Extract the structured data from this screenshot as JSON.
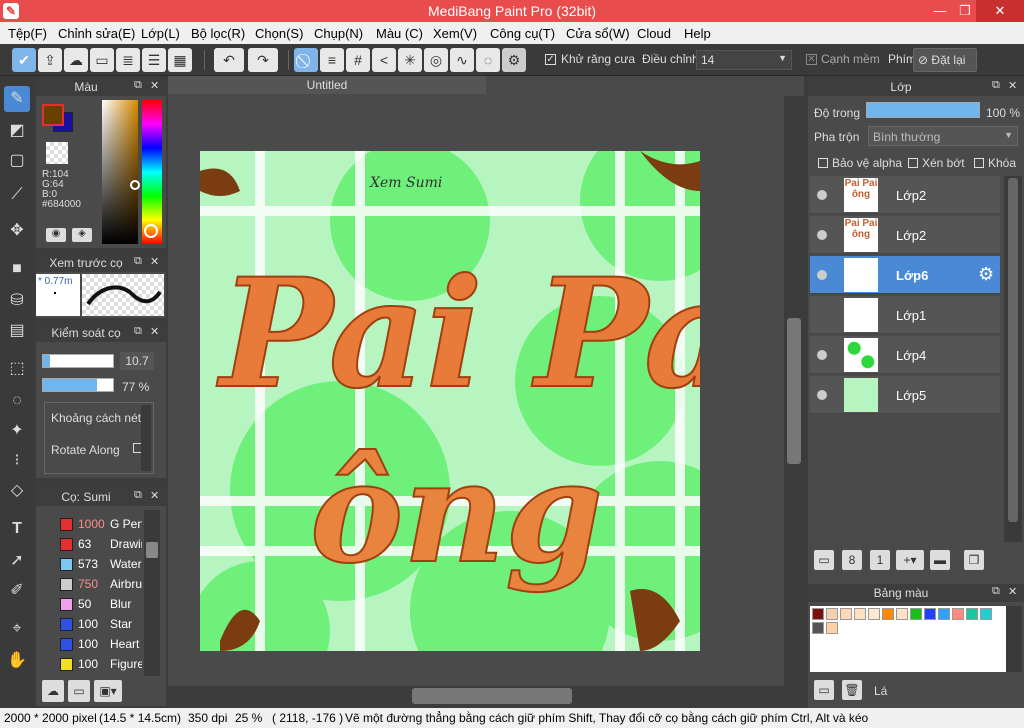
{
  "window": {
    "title": "MediBang Paint Pro (32bit)",
    "minimize": "—",
    "maximize": "❐",
    "close": "✕"
  },
  "menu": [
    "Tệp(F)",
    "Chỉnh sửa(E)",
    "Lớp(L)",
    "Bộ lọc(R)",
    "Chọn(S)",
    "Chụp(N)",
    "Màu (C)",
    "Xem(V)",
    "Công cụ(T)",
    "Cửa sổ(W)",
    "Cloud",
    "Help"
  ],
  "toolbar": {
    "antialias_label": "Khử răng cưa",
    "correction_label": "Điều chỉnh",
    "correction_value": "14",
    "soft_edge_label": "Cạnh mềm",
    "keys_label": "Phím",
    "reset_label": "Đặt lại"
  },
  "canvas": {
    "tab_title": "Untitled"
  },
  "color_panel": {
    "title": "Màu",
    "r": "R:104",
    "g": "G:64",
    "b": "B:0",
    "hex": "#684000",
    "fg_color": "#684000",
    "bg_color": "#1a10a0"
  },
  "brush_preview": {
    "title": "Xem trước cọ",
    "size": "* 0.77m"
  },
  "brush_control": {
    "title": "Kiểm soát cọ",
    "size_value": "10.7",
    "opacity_value": "77 %",
    "opacity": 0.77,
    "size_fraction": 0.1,
    "spacing_label": "Khoảng cách nét",
    "rotate_label": "Rotate Along"
  },
  "brush_list": {
    "title": "Cọ: Sumi",
    "items": [
      {
        "size": "1000",
        "name": "G Pen",
        "color": "#e03030",
        "size_color": "#ff8a8a"
      },
      {
        "size": "63",
        "name": "Drawing",
        "color": "#e03030",
        "size_color": "#ffffff"
      },
      {
        "size": "573",
        "name": "Watercolor",
        "color": "#7ec8f0",
        "size_color": "#ffffff"
      },
      {
        "size": "750",
        "name": "Airbrush",
        "color": "#cccccc",
        "size_color": "#ff8a8a"
      },
      {
        "size": "50",
        "name": "Blur",
        "color": "#f0a0e8",
        "size_color": "#ffffff"
      },
      {
        "size": "100",
        "name": "Star",
        "color": "#3050e0",
        "size_color": "#ffffff"
      },
      {
        "size": "100",
        "name": "Heart",
        "color": "#3050e0",
        "size_color": "#ffffff"
      },
      {
        "size": "100",
        "name": "Figure",
        "color": "#f0e020",
        "size_color": "#ffffff"
      }
    ]
  },
  "layer_panel": {
    "title": "Lớp",
    "opacity_label": "Độ trong",
    "opacity_value": "100 %",
    "blend_label": "Pha trộn",
    "blend_value": "Bình thường",
    "protect_alpha": "Bảo vệ alpha",
    "clipping": "Xén bớt",
    "lock": "Khóa",
    "layers": [
      {
        "name": "Lớp2",
        "selected": false
      },
      {
        "name": "Lớp2",
        "selected": false
      },
      {
        "name": "Lớp6",
        "selected": true
      },
      {
        "name": "Lớp1",
        "selected": false
      },
      {
        "name": "Lớp4",
        "selected": false
      },
      {
        "name": "Lớp5",
        "selected": false
      }
    ]
  },
  "palette": {
    "title": "Bảng màu",
    "label": "Lá",
    "colors": [
      "#7a1010",
      "#f5d0b0",
      "#ffd8b8",
      "#ffe0c0",
      "#ffe8d0",
      "#ff8a00",
      "#ffe0c8",
      "#18c018",
      "#2040ff",
      "#30a0ff",
      "#ff8a80",
      "#18c8a0",
      "#20d0d0",
      "#555555",
      "#ffd0a0"
    ]
  },
  "artwork": {
    "line1": "Pai Pai",
    "line2": "ông",
    "signature": "Xem Sumi"
  },
  "status": {
    "dimensions": "2000 * 2000 pixel",
    "size_cm": "(14.5 * 14.5cm)",
    "dpi": "350 dpi",
    "zoom": "25 %",
    "coords": "( 2118, -176 )",
    "hint": "Vẽ một đường thẳng bằng cách giữ phím Shift, Thay đổi cỡ cọ bằng cách giữ phím Ctrl, Alt và kéo"
  }
}
